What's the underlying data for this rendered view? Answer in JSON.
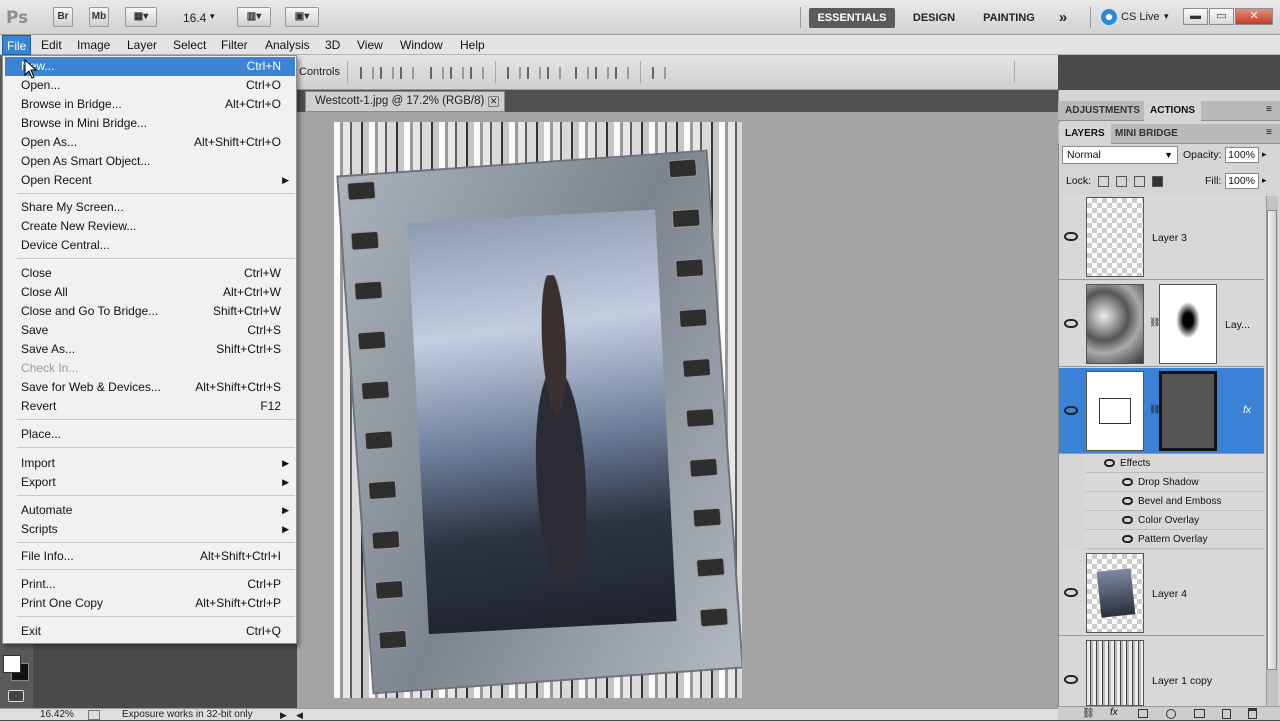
{
  "app": {
    "logo": "Ps",
    "bridge_btn": "Br",
    "minibridge_btn": "Mb",
    "zoom": "16.4",
    "cs_live": "CS Live"
  },
  "workspaces": {
    "essentials": "ESSENTIALS",
    "design": "DESIGN",
    "painting": "PAINTING",
    "more": "»"
  },
  "window_controls": {
    "minimize": "▬",
    "restore": "▭",
    "close": "✕"
  },
  "menubar": [
    "File",
    "Edit",
    "Image",
    "Layer",
    "Select",
    "Filter",
    "Analysis",
    "3D",
    "View",
    "Window",
    "Help"
  ],
  "options_bar": {
    "controls_label": "Controls"
  },
  "document": {
    "tab_title": "Westcott-1.jpg @ 17.2% (RGB/8)",
    "tab_close": "✕"
  },
  "status": {
    "zoom": "16.42%",
    "message": "Exposure works in 32-bit only"
  },
  "file_menu": {
    "items": [
      {
        "label": "New...",
        "shortcut": "Ctrl+N"
      },
      {
        "label": "Open...",
        "shortcut": "Ctrl+O"
      },
      {
        "label": "Browse in Bridge...",
        "shortcut": "Alt+Ctrl+O"
      },
      {
        "label": "Browse in Mini Bridge...",
        "shortcut": ""
      },
      {
        "label": "Open As...",
        "shortcut": "Alt+Shift+Ctrl+O"
      },
      {
        "label": "Open As Smart Object...",
        "shortcut": ""
      },
      {
        "label": "Open Recent",
        "shortcut": ""
      },
      {
        "label": "Share My Screen...",
        "shortcut": ""
      },
      {
        "label": "Create New Review...",
        "shortcut": ""
      },
      {
        "label": "Device Central...",
        "shortcut": ""
      },
      {
        "label": "Close",
        "shortcut": "Ctrl+W"
      },
      {
        "label": "Close All",
        "shortcut": "Alt+Ctrl+W"
      },
      {
        "label": "Close and Go To Bridge...",
        "shortcut": "Shift+Ctrl+W"
      },
      {
        "label": "Save",
        "shortcut": "Ctrl+S"
      },
      {
        "label": "Save As...",
        "shortcut": "Shift+Ctrl+S"
      },
      {
        "label": "Check In...",
        "shortcut": ""
      },
      {
        "label": "Save for Web & Devices...",
        "shortcut": "Alt+Shift+Ctrl+S"
      },
      {
        "label": "Revert",
        "shortcut": "F12"
      },
      {
        "label": "Place...",
        "shortcut": ""
      },
      {
        "label": "Import",
        "shortcut": ""
      },
      {
        "label": "Export",
        "shortcut": ""
      },
      {
        "label": "Automate",
        "shortcut": ""
      },
      {
        "label": "Scripts",
        "shortcut": ""
      },
      {
        "label": "File Info...",
        "shortcut": "Alt+Shift+Ctrl+I"
      },
      {
        "label": "Print...",
        "shortcut": "Ctrl+P"
      },
      {
        "label": "Print One Copy",
        "shortcut": "Alt+Shift+Ctrl+P"
      },
      {
        "label": "Exit",
        "shortcut": "Ctrl+Q"
      }
    ]
  },
  "panels": {
    "top_tabs": [
      "ADJUSTMENTS",
      "ACTIONS"
    ],
    "layer_tabs": [
      "LAYERS",
      "MINI BRIDGE"
    ],
    "blend_mode": "Normal",
    "opacity_label": "Opacity:",
    "opacity_value": "100%",
    "lock_label": "Lock:",
    "fill_label": "Fill:",
    "fill_value": "100%",
    "layers": [
      {
        "name": "Layer 3"
      },
      {
        "name": "Lay..."
      },
      {
        "name": ""
      },
      {
        "name": "Layer 4"
      },
      {
        "name": "Layer 1 copy"
      }
    ],
    "fx_label": "fx",
    "effects_label": "Effects",
    "effects": [
      "Drop Shadow",
      "Bevel and Emboss",
      "Color Overlay",
      "Pattern Overlay"
    ]
  }
}
